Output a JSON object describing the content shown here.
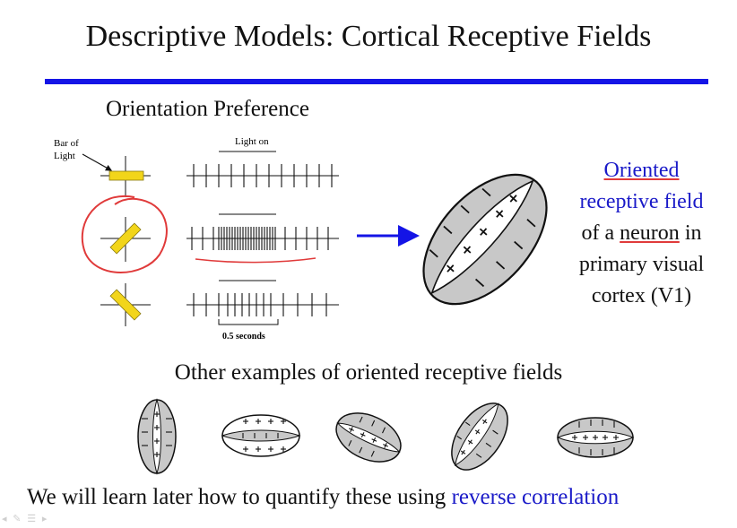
{
  "slide": {
    "title": "Descriptive Models: Cortical Receptive Fields",
    "subheading": "Orientation Preference",
    "diagram": {
      "bar_label": [
        "Bar of",
        "Light"
      ],
      "light_on_label": "Light on",
      "time_label": "0.5 seconds"
    },
    "side_text": {
      "line1": "Oriented",
      "line2": "receptive field",
      "line3_prefix": "of a ",
      "line3_highlight": "neuron",
      "line3_suffix": " in",
      "line4": "primary visual",
      "line5": "cortex (V1)"
    },
    "examples_heading": "Other examples of oriented receptive fields",
    "footer": {
      "prefix": "We will learn later how to quantify these using ",
      "link": "reverse correlation"
    },
    "colors": {
      "accent_blue": "#1414e6",
      "text_blue": "#1a1ac8",
      "bar_yellow": "#f2d51a",
      "annotation_red": "#e03a3a",
      "field_gray": "#c8c8c8"
    }
  }
}
